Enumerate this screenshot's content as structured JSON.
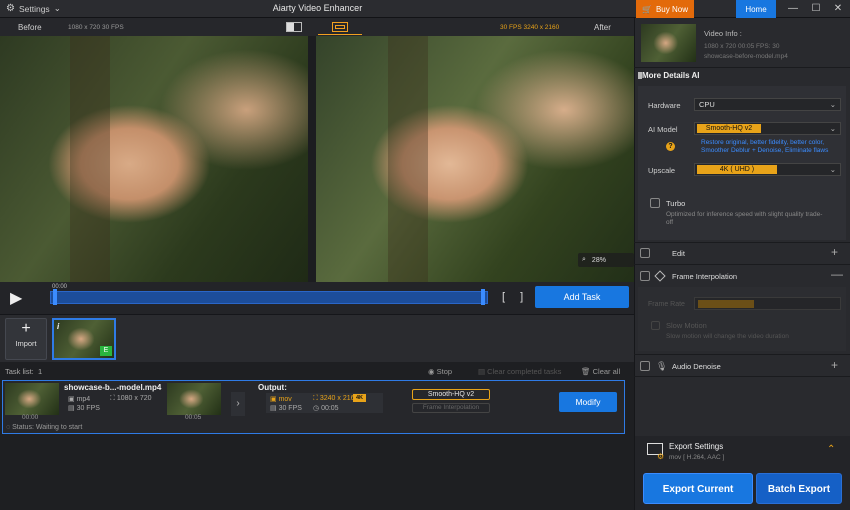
{
  "app": {
    "title": "Aiarty Video Enhancer",
    "settings_label": "Settings"
  },
  "header": {
    "buy_now": "Buy Now",
    "home": "Home"
  },
  "preview": {
    "before_label": "Before",
    "before_info": "1080 x 720  30 FPS",
    "after_info": "30 FPS  3240 x 2160",
    "after_label": "After",
    "zoom": "28%"
  },
  "transport": {
    "timecode": "00:00",
    "add_task": "Add Task"
  },
  "thumbs": {
    "import_label": "Import",
    "badge_i": "i",
    "badge_e": "E"
  },
  "tasklist": {
    "label": "Task list:",
    "count": "1",
    "stop": "Stop",
    "clear_completed": "Clear completed tasks",
    "clear_all": "Clear all"
  },
  "task": {
    "input_name": "showcase-b...-model.mp4",
    "input_format": "mp4",
    "input_resolution": "1080 x 720",
    "input_fps": "30 FPS",
    "input_time": "00:00",
    "output_time": "00:05",
    "output_label": "Output:",
    "output_format": "mov",
    "output_resolution": "3240 x 2160",
    "output_badge": "4K",
    "output_fps": "30 FPS",
    "output_duration": "00:05",
    "model_chip": "Smooth-HQ  v2",
    "fi_chip": "Frame Interpolation",
    "modify": "Modify",
    "status": "Status: Waiting to start"
  },
  "video_info": {
    "title": "Video Info :",
    "line1": "1080 x 720  00:05   FPS: 30",
    "line2": "showcase-before-model.mp4"
  },
  "ai": {
    "section": "More Details AI",
    "hardware_label": "Hardware",
    "hardware_value": "CPU",
    "model_label": "AI Model",
    "model_value": "Smooth-HQ  v2",
    "model_desc": "Restore original, better fidelity, better color, Smoother Deblur + Denoise, Eliminate flaws",
    "upscale_label": "Upscale",
    "upscale_value": "4K  ( UHD )",
    "turbo_label": "Turbo",
    "turbo_desc": "Optimized for inference speed with slight quality trade-off"
  },
  "sections": {
    "edit": "Edit",
    "frame_interp": "Frame Interpolation",
    "frame_rate": "Frame Rate",
    "slow_motion": "Slow Motion",
    "slow_desc": "Slow motion will change the video duration",
    "audio_denoise": "Audio Denoise"
  },
  "export": {
    "title": "Export Settings",
    "subtitle": "mov [ H.264, AAC ]",
    "current": "Export Current",
    "batch": "Batch Export"
  },
  "colors": {
    "accent_blue": "#1877e0",
    "accent_orange": "#e8a319",
    "buy_orange": "#e36a0a"
  }
}
